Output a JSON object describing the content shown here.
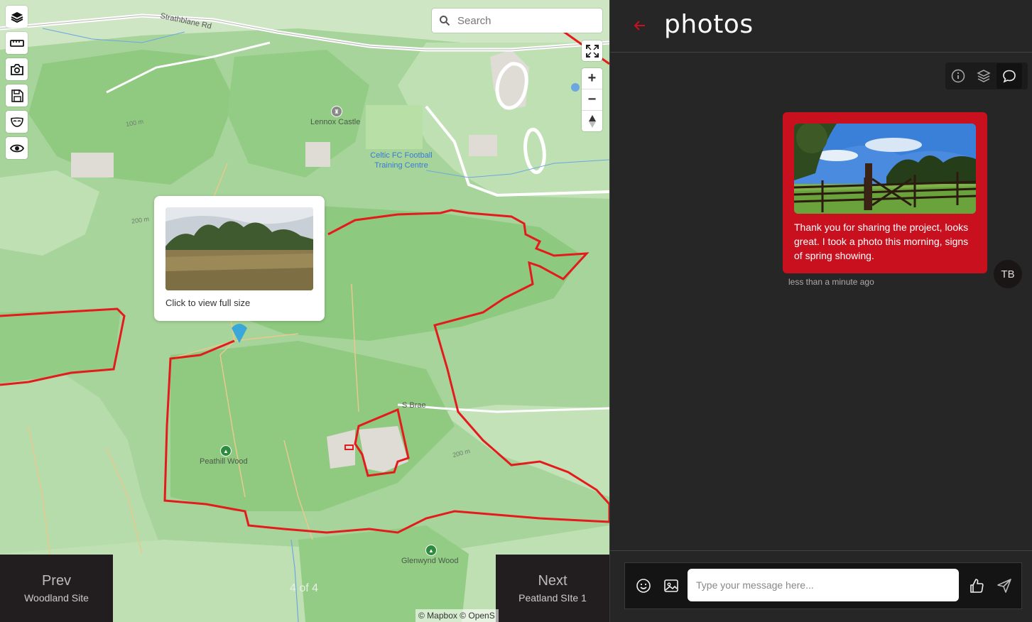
{
  "map": {
    "search_placeholder": "Search",
    "labels": {
      "strathblane_rd": "Strathblane Rd",
      "lennox_castle": "Lennox Castle",
      "celtic_fc": "Celtic FC Football Training Centre",
      "s_brae": "S Brae",
      "peathill_wood": "Peathill Wood",
      "glenwynd_wood": "Glenwynd Wood",
      "contour_100_top": "100 m",
      "contour_200_left": "200 m",
      "contour_200_right": "200 m"
    },
    "popup_caption": "Click to view full size",
    "attribution": "© Mapbox © OpenS",
    "toolbar_icons": [
      "layers-icon",
      "ruler-icon",
      "camera-icon",
      "save-icon",
      "mask-icon",
      "eye-icon"
    ],
    "boundary_color": "#e41a1c",
    "pin_color": "#3aa7d9"
  },
  "nav": {
    "prev": {
      "label": "Prev",
      "sub": "Woodland Site"
    },
    "next": {
      "label": "Next",
      "sub": "Peatland SIte 1"
    },
    "pager": "4 of 4"
  },
  "panel": {
    "title": "photos",
    "accent_color": "#c8101e",
    "tabs": [
      "info-icon",
      "layers-icon",
      "chat-icon"
    ],
    "active_tab": "chat-icon",
    "message": {
      "text": "Thank you for sharing the project, looks great. I took a photo this morning, signs of spring showing.",
      "author_initials": "TB",
      "time": "less than a minute ago"
    },
    "composer": {
      "placeholder": "Type your message here..."
    }
  }
}
